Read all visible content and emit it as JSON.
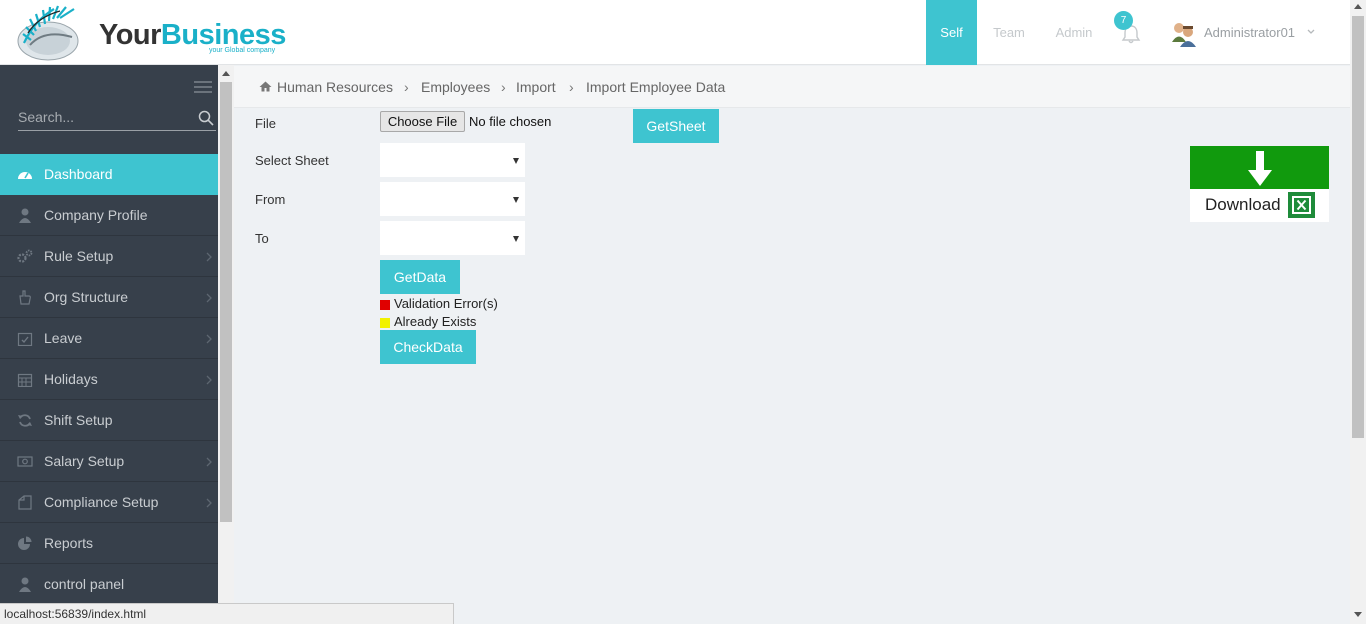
{
  "logo": {
    "word1": "Your",
    "word2": "Business",
    "tagline": "your Global company"
  },
  "topnav": {
    "self": "Self",
    "team": "Team",
    "admin": "Admin",
    "notifications_count": "7",
    "username": "Administrator01"
  },
  "sidebar": {
    "search_placeholder": "Search...",
    "items": [
      {
        "label": "Dashboard",
        "icon": "dashboard-icon",
        "active": true,
        "chevron": false
      },
      {
        "label": "Company Profile",
        "icon": "user-icon",
        "chevron": false
      },
      {
        "label": "Rule Setup",
        "icon": "cogs-icon",
        "chevron": true
      },
      {
        "label": "Org Structure",
        "icon": "hand-icon",
        "chevron": true
      },
      {
        "label": "Leave",
        "icon": "calendar-check-icon",
        "chevron": true
      },
      {
        "label": "Holidays",
        "icon": "calendar-icon",
        "chevron": true
      },
      {
        "label": "Shift Setup",
        "icon": "refresh-icon",
        "chevron": false
      },
      {
        "label": "Salary Setup",
        "icon": "money-icon",
        "chevron": true
      },
      {
        "label": "Compliance Setup",
        "icon": "clipboard-icon",
        "chevron": true
      },
      {
        "label": "Reports",
        "icon": "pie-chart-icon",
        "chevron": false
      },
      {
        "label": "control panel",
        "icon": "user-icon",
        "chevron": false
      }
    ]
  },
  "breadcrumb": [
    "Human Resources",
    "Employees",
    "Import",
    "Import Employee Data"
  ],
  "form": {
    "file_label": "File",
    "choose_file": "Choose File",
    "no_file": "No file chosen",
    "getsheet": "GetSheet",
    "select_sheet_label": "Select Sheet",
    "from_label": "From",
    "to_label": "To",
    "select_sheet_value": "",
    "from_value": "",
    "to_value": "",
    "getdata": "GetData",
    "legend": [
      {
        "label": "Validation Error(s)",
        "color": "#e00000"
      },
      {
        "label": "Already Exists",
        "color": "#f2f200"
      }
    ],
    "checkdata": "CheckData"
  },
  "download": {
    "label": "Download",
    "icon": "excel-icon"
  },
  "status_bar": "localhost:56839/index.html",
  "colors": {
    "accent": "#3ec4d0",
    "sidebar_bg": "#37404b",
    "download_green": "#119a0d"
  }
}
